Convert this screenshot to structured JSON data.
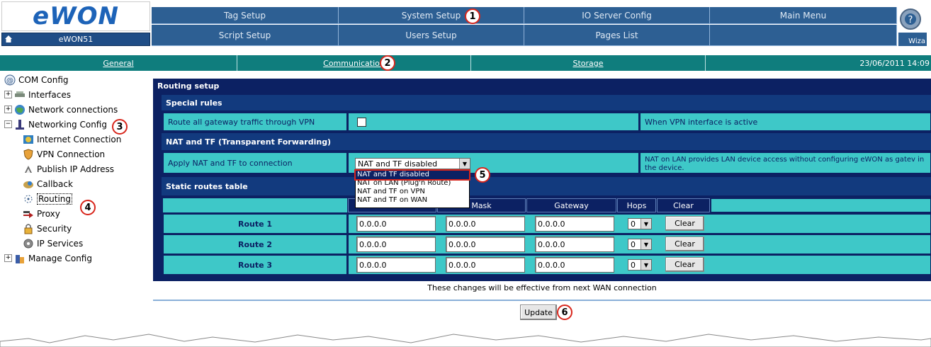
{
  "header": {
    "logo_text": "eWON",
    "device_name": "eWON51",
    "nav_row1": [
      "Tag Setup",
      "System Setup",
      "IO Server Config",
      "Main Menu"
    ],
    "nav_row2": [
      "Script Setup",
      "Users Setup",
      "Pages List",
      ""
    ],
    "wizard_label": "Wiza"
  },
  "subnav": {
    "tabs": [
      "General",
      "Communication",
      "Storage"
    ],
    "datetime": "23/06/2011 14:09"
  },
  "callouts": [
    "1",
    "2",
    "3",
    "4",
    "5",
    "6"
  ],
  "tree": {
    "root": "COM Config",
    "items": [
      {
        "label": "Interfaces",
        "icon": "interfaces-icon"
      },
      {
        "label": "Network connections",
        "icon": "globe-icon"
      },
      {
        "label": "Networking Config",
        "icon": "network-config-icon"
      },
      {
        "label": "Internet Connection",
        "icon": "internet-icon"
      },
      {
        "label": "VPN Connection",
        "icon": "shield-icon"
      },
      {
        "label": "Publish IP Address",
        "icon": "publish-icon"
      },
      {
        "label": "Callback",
        "icon": "callback-icon"
      },
      {
        "label": "Routing",
        "icon": "routing-icon"
      },
      {
        "label": "Proxy",
        "icon": "proxy-icon"
      },
      {
        "label": "Security",
        "icon": "lock-icon"
      },
      {
        "label": "IP Services",
        "icon": "gear-icon"
      },
      {
        "label": "Manage Config",
        "icon": "manage-config-icon"
      }
    ]
  },
  "routing": {
    "title": "Routing setup",
    "special_rules": {
      "title": "Special rules",
      "vpn_label": "Route all gateway traffic through VPN",
      "vpn_checked": false,
      "vpn_note": "When VPN interface is active"
    },
    "nat": {
      "title": "NAT and TF (Transparent Forwarding)",
      "label": "Apply NAT and TF to connection",
      "selected": "NAT and TF disabled",
      "options": [
        "NAT and TF disabled",
        "NAT on LAN (Plug'n Route)",
        "NAT and TF on VPN",
        "NAT and TF on WAN"
      ],
      "note": "NAT on LAN provides LAN device access without configuring eWON as gatev in the device."
    },
    "static_routes": {
      "title": "Static routes table",
      "headers": [
        "Mask",
        "Gateway",
        "Hops",
        "Clear"
      ],
      "rows": [
        {
          "name": "Route 1",
          "dest": "0.0.0.0",
          "mask": "0.0.0.0",
          "gateway": "0.0.0.0",
          "hops": "0",
          "clear": "Clear"
        },
        {
          "name": "Route 2",
          "dest": "0.0.0.0",
          "mask": "0.0.0.0",
          "gateway": "0.0.0.0",
          "hops": "0",
          "clear": "Clear"
        },
        {
          "name": "Route 3",
          "dest": "0.0.0.0",
          "mask": "0.0.0.0",
          "gateway": "0.0.0.0",
          "hops": "0",
          "clear": "Clear"
        }
      ]
    },
    "footer_note": "These changes will be effective from next WAN connection",
    "update_label": "Update"
  }
}
